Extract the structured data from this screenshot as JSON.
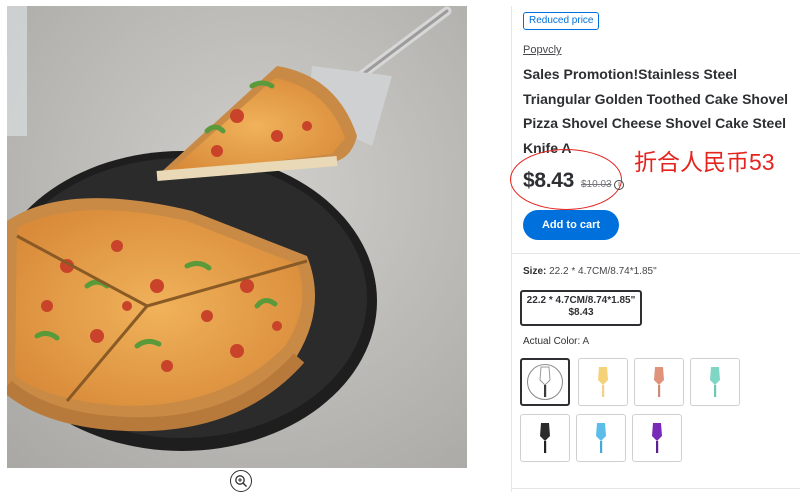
{
  "product": {
    "badge": "Reduced price",
    "brand": "Popvcly",
    "title": "Sales Promotion!Stainless Steel Triangular Golden Toothed Cake Shovel Pizza Shovel Cheese Shovel Cake Steel Knife A",
    "price": "$8.43",
    "old_price": "$10.03",
    "add_to_cart_label": "Add to cart"
  },
  "annotation": "折合人民币53",
  "size": {
    "label": "Size:",
    "value": "22.2 * 4.7CM/8.74*1.85\"",
    "option_label": "22.2 * 4.7CM/8.74*1.85\"",
    "option_price": "$8.43"
  },
  "color": {
    "label": "Actual Color:",
    "value": "A",
    "swatches": [
      {
        "name": "A",
        "color": "#ffffff",
        "selected": true
      },
      {
        "name": "gold",
        "color": "#f3d27a",
        "selected": false
      },
      {
        "name": "copper",
        "color": "#e0927a",
        "selected": false
      },
      {
        "name": "mint",
        "color": "#7fd6c4",
        "selected": false
      },
      {
        "name": "black",
        "color": "#2b2b2b",
        "selected": false
      },
      {
        "name": "blue",
        "color": "#5bbde8",
        "selected": false
      },
      {
        "name": "purple",
        "color": "#7a2ab8",
        "selected": false
      }
    ]
  },
  "colors": {
    "accent": "#0071dc",
    "annotation_red": "#e4241f"
  },
  "icons": {
    "zoom": "zoom-in-icon",
    "info": "info-icon"
  }
}
